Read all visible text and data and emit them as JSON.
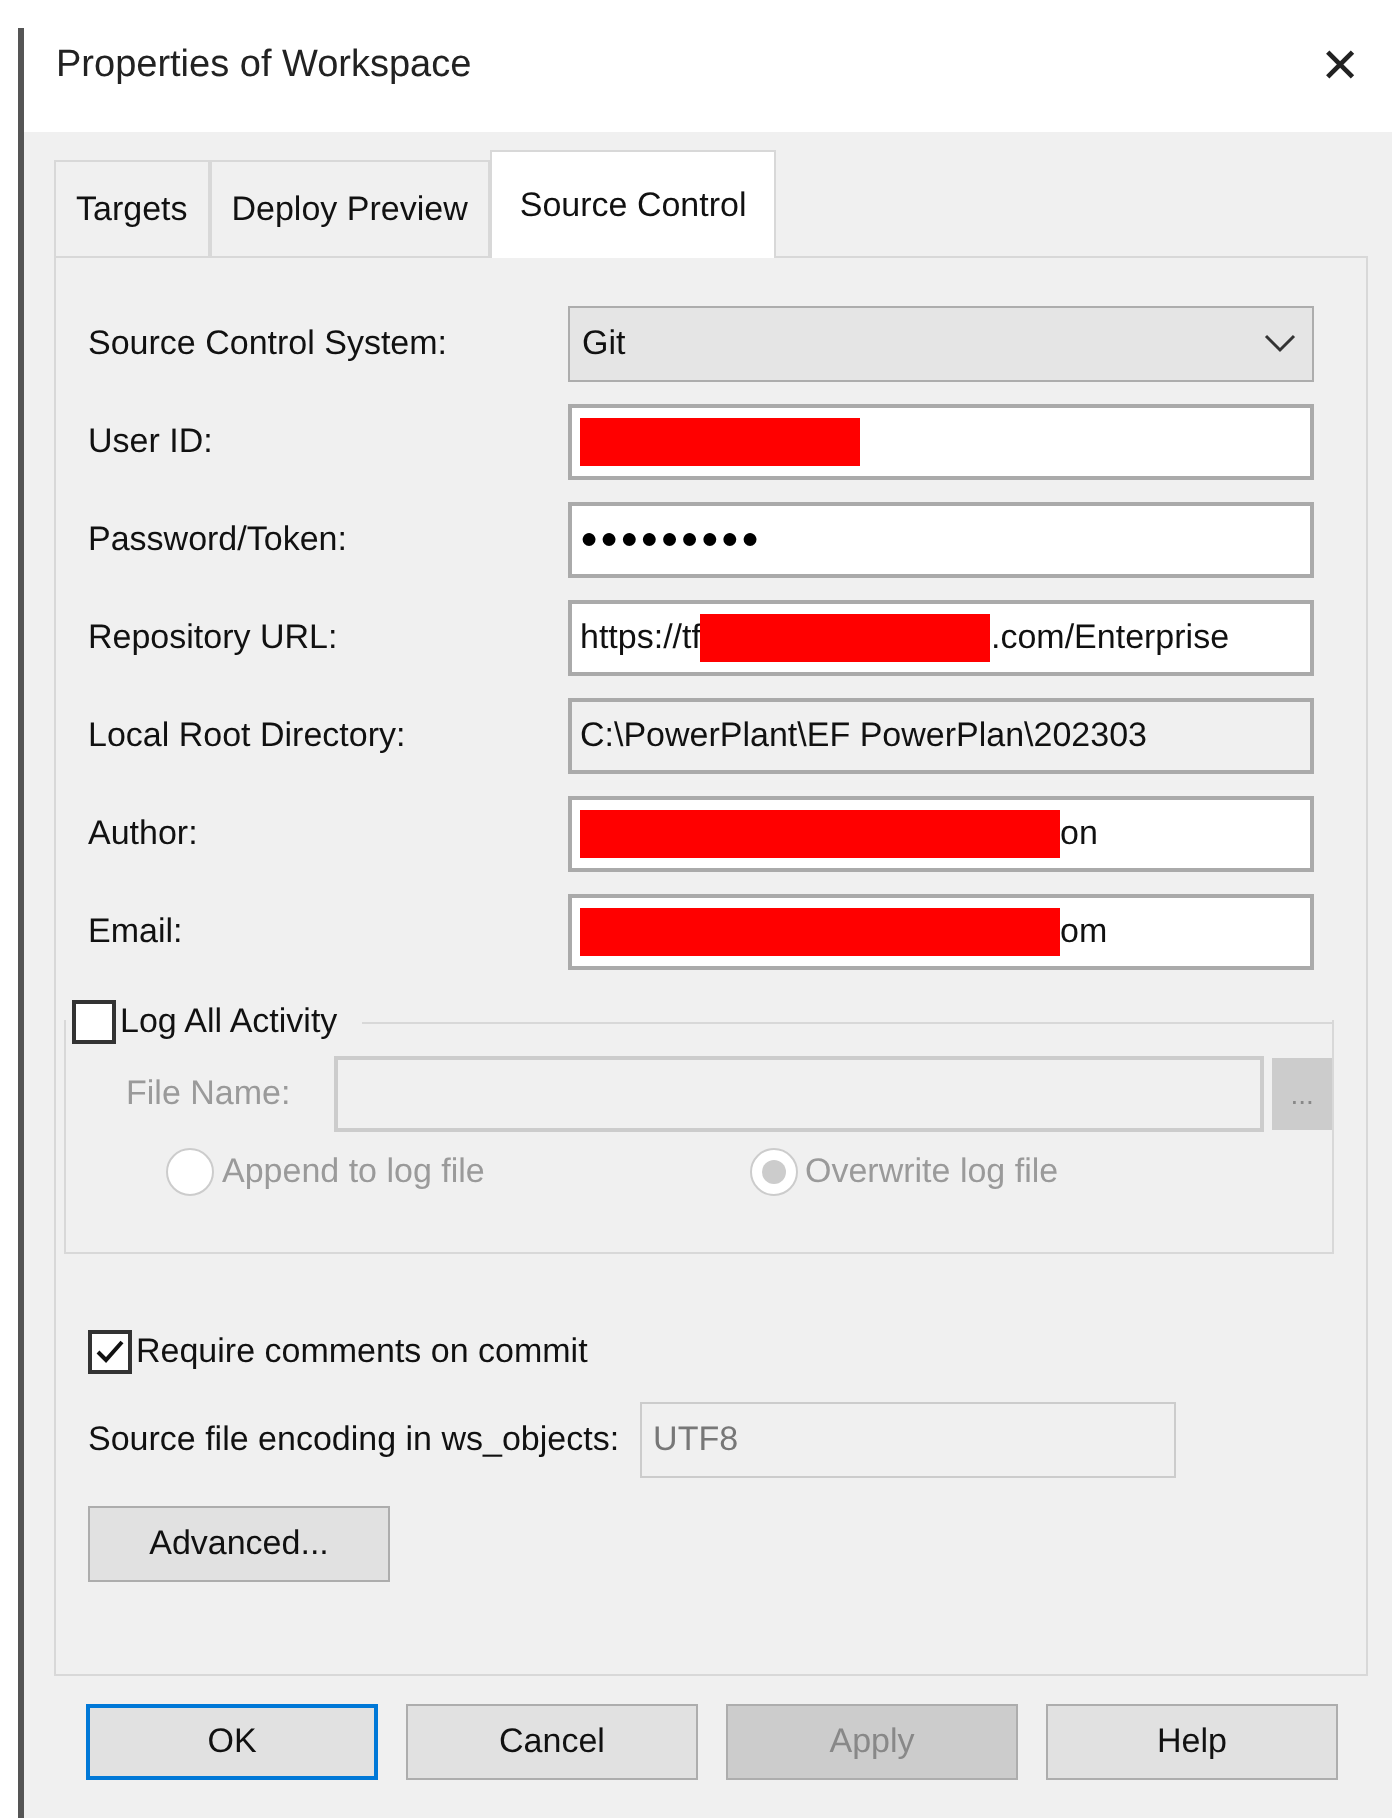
{
  "window": {
    "title": "Properties of Workspace",
    "close": "✕"
  },
  "tabs": [
    {
      "label": "Targets",
      "selected": false
    },
    {
      "label": "Deploy Preview",
      "selected": false
    },
    {
      "label": "Source Control",
      "selected": true
    }
  ],
  "fields": [
    {
      "label": "Source Control System:",
      "kind": "dropdown",
      "value": "Git",
      "redacted": false
    },
    {
      "label": "User ID:",
      "kind": "text",
      "redacted": true
    },
    {
      "label": "Password/Token:",
      "kind": "password",
      "value": "●●●●●●●●●",
      "redacted": false
    },
    {
      "label": "Repository URL:",
      "kind": "text",
      "value": "https://tf",
      "value_after": ".com/Enterprise",
      "redacted": true
    },
    {
      "label": "Local Root Directory:",
      "kind": "readonly",
      "value": "C:\\PowerPlant\\EF PowerPlan\\202303",
      "redacted": false
    },
    {
      "label": "Author:",
      "kind": "text",
      "value_after": "on",
      "redacted": true
    },
    {
      "label": "Email:",
      "kind": "text",
      "value_after": "om",
      "redacted": true
    }
  ],
  "log": {
    "label": "Log All Activity",
    "checked": false,
    "file_label": "File Name:",
    "browse": "...",
    "disabled": true,
    "options": [
      {
        "label": "Append to log file",
        "selected": false
      },
      {
        "label": "Overwrite log file",
        "selected": true
      }
    ]
  },
  "require_comments": {
    "label": "Require comments on commit",
    "checked": true
  },
  "encoding": {
    "label": "Source file encoding in ws_objects:",
    "value": "UTF8",
    "disabled": true
  },
  "advanced": "Advanced...",
  "buttons": [
    {
      "label": "OK",
      "default": true,
      "disabled": false
    },
    {
      "label": "Cancel",
      "default": false,
      "disabled": false
    },
    {
      "label": "Apply",
      "default": false,
      "disabled": true
    },
    {
      "label": "Help",
      "default": false,
      "disabled": false
    }
  ]
}
